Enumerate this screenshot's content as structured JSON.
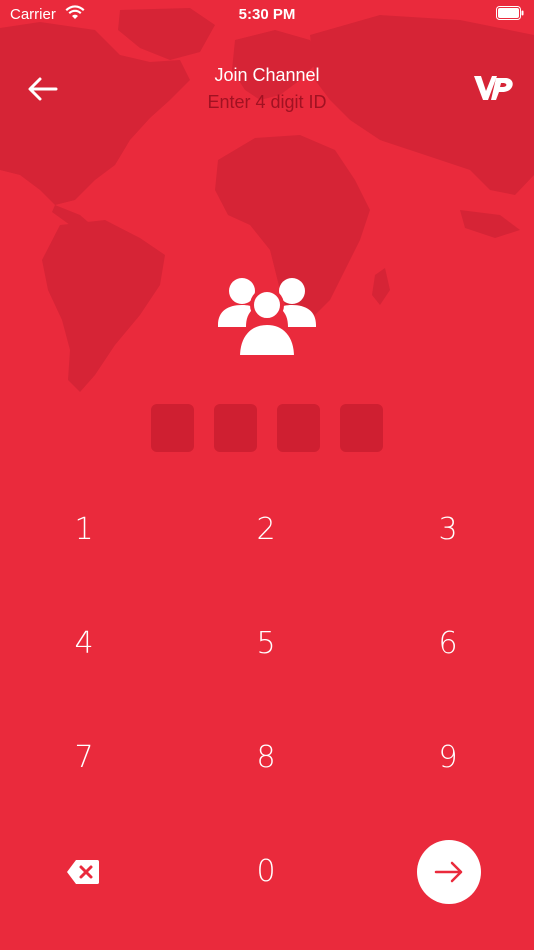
{
  "status_bar": {
    "carrier": "Carrier",
    "time": "5:30 PM"
  },
  "header": {
    "title": "Join Channel",
    "subtitle": "Enter 4 digit ID",
    "back_icon": "arrow-left-icon",
    "logo_icon": "vp-logo-icon"
  },
  "pin": {
    "length": 4,
    "digits": [
      "",
      "",
      "",
      ""
    ]
  },
  "keypad": {
    "keys": [
      "1",
      "2",
      "3",
      "4",
      "5",
      "6",
      "7",
      "8",
      "9"
    ],
    "zero": "0",
    "delete_icon": "backspace-icon",
    "submit_icon": "arrow-right-icon"
  },
  "colors": {
    "background": "#ea2a3c",
    "map": "#d62436",
    "pin_box": "#cf1f31",
    "subtitle": "#a11222",
    "accent": "#ffffff"
  }
}
